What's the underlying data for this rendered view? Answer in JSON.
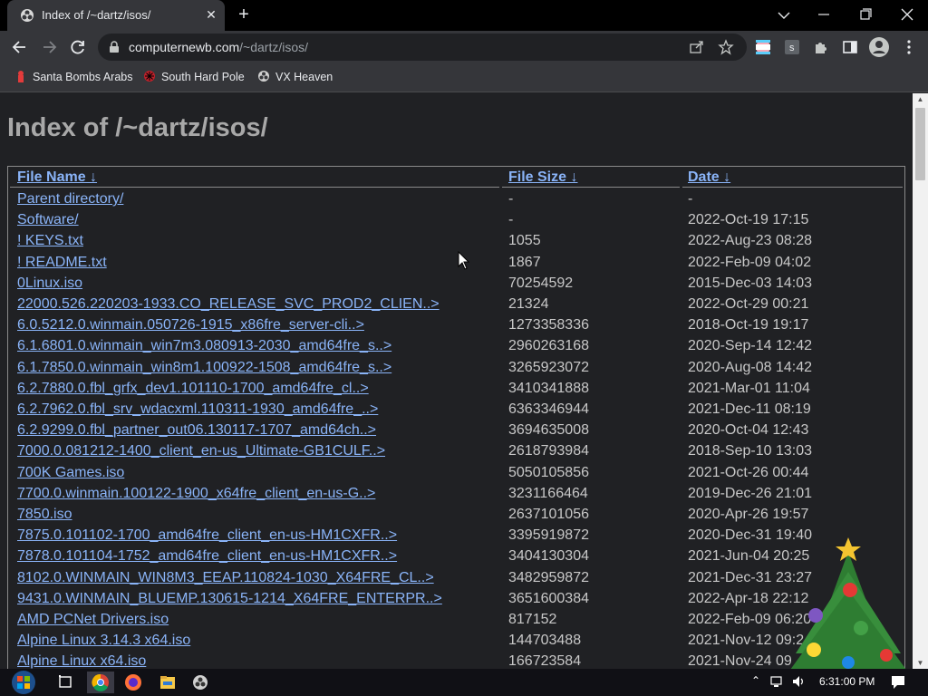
{
  "browser": {
    "tab_title": "Index of /~dartz/isos/",
    "tab_close": "✕",
    "new_tab": "+",
    "url_host": "computernewb.com",
    "url_path": "/~dartz/isos/"
  },
  "bookmarks": [
    {
      "label": "Santa Bombs Arabs",
      "icon": "bookmark-favicon-red"
    },
    {
      "label": "South Hard Pole",
      "icon": "bookmark-favicon-snowflake"
    },
    {
      "label": "VX Heaven",
      "icon": "bookmark-favicon-bio"
    }
  ],
  "page": {
    "heading": "Index of /~dartz/isos/",
    "columns": {
      "name": "File Name  ↓",
      "size": "File Size  ↓",
      "date": "Date  ↓"
    },
    "rows": [
      {
        "name": "Parent directory/",
        "size": "-",
        "date": "-"
      },
      {
        "name": "Software/",
        "size": "-",
        "date": "2022-Oct-19 17:15"
      },
      {
        "name": "! KEYS.txt",
        "size": "1055",
        "date": "2022-Aug-23 08:28"
      },
      {
        "name": "! README.txt",
        "size": "1867",
        "date": "2022-Feb-09 04:02"
      },
      {
        "name": "0Linux.iso",
        "size": "70254592",
        "date": "2015-Dec-03 14:03"
      },
      {
        "name": "22000.526.220203-1933.CO_RELEASE_SVC_PROD2_CLIEN..>",
        "size": "21324",
        "date": "2022-Oct-29 00:21"
      },
      {
        "name": "6.0.5212.0.winmain.050726-1915_x86fre_server-cli..>",
        "size": "1273358336",
        "date": "2018-Oct-19 19:17"
      },
      {
        "name": "6.1.6801.0.winmain_win7m3.080913-2030_amd64fre_s..>",
        "size": "2960263168",
        "date": "2020-Sep-14 12:42"
      },
      {
        "name": "6.1.7850.0.winmain_win8m1.100922-1508_amd64fre_s..>",
        "size": "3265923072",
        "date": "2020-Aug-08 14:42"
      },
      {
        "name": "6.2.7880.0.fbl_grfx_dev1.101110-1700_amd64fre_cl..>",
        "size": "3410341888",
        "date": "2021-Mar-01 11:04"
      },
      {
        "name": "6.2.7962.0.fbl_srv_wdacxml.110311-1930_amd64fre_..>",
        "size": "6363346944",
        "date": "2021-Dec-11 08:19"
      },
      {
        "name": "6.2.9299.0.fbl_partner_out06.130117-1707_amd64ch..>",
        "size": "3694635008",
        "date": "2020-Oct-04 12:43"
      },
      {
        "name": "7000.0.081212-1400_client_en-us_Ultimate-GB1CULF..>",
        "size": "2618793984",
        "date": "2018-Sep-10 13:03"
      },
      {
        "name": "700K Games.iso",
        "size": "5050105856",
        "date": "2021-Oct-26 00:44"
      },
      {
        "name": "7700.0.winmain.100122-1900_x64fre_client_en-us-G..>",
        "size": "3231166464",
        "date": "2019-Dec-26 21:01"
      },
      {
        "name": "7850.iso",
        "size": "2637101056",
        "date": "2020-Apr-26 19:57"
      },
      {
        "name": "7875.0.101102-1700_amd64fre_client_en-us-HM1CXFR..>",
        "size": "3395919872",
        "date": "2020-Dec-31 19:40"
      },
      {
        "name": "7878.0.101104-1752_amd64fre_client_en-us-HM1CXFR..>",
        "size": "3404130304",
        "date": "2021-Jun-04 20:25"
      },
      {
        "name": "8102.0.WINMAIN_WIN8M3_EEAP.110824-1030_X64FRE_CL..>",
        "size": "3482959872",
        "date": "2021-Dec-31 23:27"
      },
      {
        "name": "9431.0.WINMAIN_BLUEMP.130615-1214_X64FRE_ENTERPR..>",
        "size": "3651600384",
        "date": "2022-Apr-18 22:12"
      },
      {
        "name": "AMD PCNet Drivers.iso",
        "size": "817152",
        "date": "2022-Feb-09 06:20"
      },
      {
        "name": "Alpine Linux 3.14.3 x64.iso",
        "size": "144703488",
        "date": "2021-Nov-12 09:2"
      },
      {
        "name": "Alpine Linux x64.iso",
        "size": "166723584",
        "date": "2021-Nov-24 09"
      }
    ]
  },
  "taskbar": {
    "clock": "6:31:00 PM",
    "apps": [
      "chrome-icon",
      "firefox-icon",
      "file-explorer-icon",
      "app-icon"
    ]
  }
}
